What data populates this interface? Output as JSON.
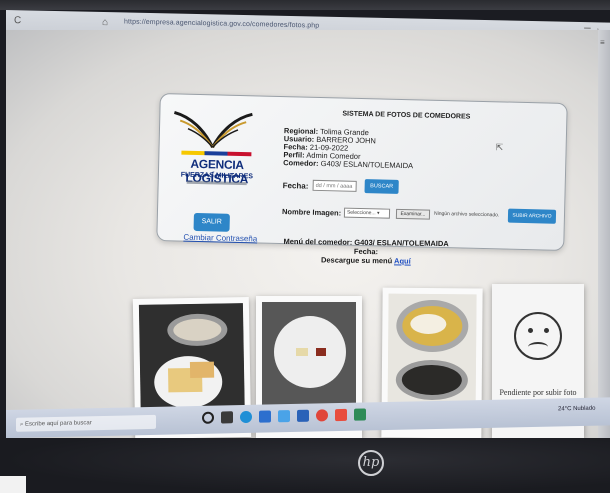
{
  "browser": {
    "url": "https://empresa.agencialogistica.gov.co/comedores/fotos.php",
    "back_glyph": "C",
    "home_glyph": "⌂",
    "side_glyph": "☰ ☆"
  },
  "card": {
    "title": "SISTEMA DE FOTOS DE COMEDORES",
    "logo_text": "AGENCIA LOGÍSTICA",
    "logo_sub": "FUERZAS MILITARES",
    "regional_label": "Regional:",
    "regional_value": "Tolima Grande",
    "usuario_label": "Usuario:",
    "usuario_value": "BARRERO JOHN",
    "fecha_label": "Fecha:",
    "fecha_value": "21-09-2022",
    "perfil_label": "Perfil:",
    "perfil_value": "Admin Comedor",
    "comedor_label": "Comedor:",
    "comedor_value": "G403/ ESLAN/TOLEMAIDA",
    "date_input_label": "Fecha:",
    "date_input_placeholder": "dd / mm / aaaa",
    "buscar_label": "BUSCAR",
    "nombre_label": "Nombre Imagen:",
    "select_value": "Seleccione...",
    "select_arrow": "▾",
    "examinar_label": "Examinar...",
    "ningun_text": "Ningún archivo seleccionado.",
    "subir_label": "SUBIR ARCHIVO",
    "salir_label": "SALIR",
    "cambiar_label": "Cambiar Contraseña"
  },
  "menu": {
    "line1": "Menú del comedor: G403/ ESLAN/TOLEMAIDA",
    "line2": "Fecha:",
    "line3_prefix": "Descargue su menú",
    "line3_link": "Aquí"
  },
  "tiles": {
    "pending_text": "Pendiente por subir foto"
  },
  "taskbar": {
    "search_placeholder": "Escribe aquí para buscar",
    "weather": "24°C  Nublado"
  },
  "colors": {
    "accent_button": "#2e86c8",
    "logo_blue": "#0f2d7c",
    "link_blue": "#1f4fc2"
  }
}
